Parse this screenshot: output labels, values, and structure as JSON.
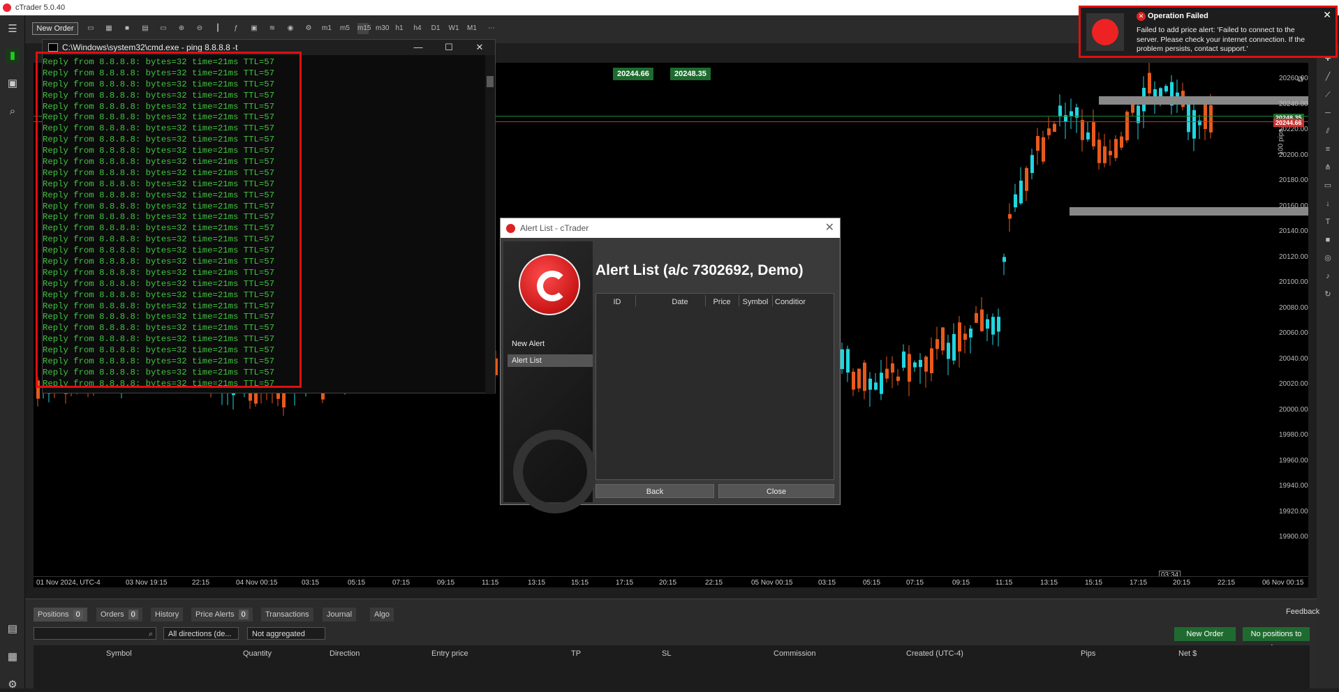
{
  "app": {
    "title": "cTrader 5.0.40"
  },
  "toolbar": {
    "new_order": "New Order",
    "timeframes": [
      "m1",
      "m5",
      "m15",
      "m30",
      "h1",
      "h4",
      "D1",
      "W1",
      "M1"
    ]
  },
  "cmd": {
    "title": "C:\\Windows\\system32\\cmd.exe - ping  8.8.8.8 -t",
    "lines": [
      "Reply from 8.8.8.8: bytes=32 time=21ms TTL=57",
      "Reply from 8.8.8.8: bytes=32 time=21ms TTL=57",
      "Reply from 8.8.8.8: bytes=32 time=21ms TTL=57",
      "Reply from 8.8.8.8: bytes=32 time=21ms TTL=57",
      "Reply from 8.8.8.8: bytes=32 time=21ms TTL=57",
      "Reply from 8.8.8.8: bytes=32 time=21ms TTL=57",
      "Reply from 8.8.8.8: bytes=32 time=21ms TTL=57",
      "Reply from 8.8.8.8: bytes=32 time=21ms TTL=57",
      "Reply from 8.8.8.8: bytes=32 time=21ms TTL=57",
      "Reply from 8.8.8.8: bytes=32 time=21ms TTL=57",
      "Reply from 8.8.8.8: bytes=32 time=21ms TTL=57",
      "Reply from 8.8.8.8: bytes=32 time=21ms TTL=57",
      "Reply from 8.8.8.8: bytes=32 time=21ms TTL=57",
      "Reply from 8.8.8.8: bytes=32 time=21ms TTL=57",
      "Reply from 8.8.8.8: bytes=32 time=21ms TTL=57",
      "Reply from 8.8.8.8: bytes=32 time=21ms TTL=57",
      "Reply from 8.8.8.8: bytes=32 time=21ms TTL=57",
      "Reply from 8.8.8.8: bytes=32 time=21ms TTL=57",
      "Reply from 8.8.8.8: bytes=32 time=21ms TTL=57",
      "Reply from 8.8.8.8: bytes=32 time=21ms TTL=57",
      "Reply from 8.8.8.8: bytes=32 time=21ms TTL=57",
      "Reply from 8.8.8.8: bytes=32 time=21ms TTL=57",
      "Reply from 8.8.8.8: bytes=32 time=21ms TTL=57",
      "Reply from 8.8.8.8: bytes=32 time=21ms TTL=57",
      "Reply from 8.8.8.8: bytes=32 time=21ms TTL=57",
      "Reply from 8.8.8.8: bytes=32 time=21ms TTL=57",
      "Reply from 8.8.8.8: bytes=32 time=21ms TTL=57",
      "Reply from 8.8.8.8: bytes=32 time=21ms TTL=57",
      "Reply from 8.8.8.8: bytes=32 time=21ms TTL=57",
      "Reply from 8.8.8.8: bytes=32 time=21ms TTL=57"
    ]
  },
  "alert_dialog": {
    "window_title": "Alert List - cTrader",
    "heading": "Alert List (a/c 7302692, Demo)",
    "sidebar": [
      "New Alert",
      "Alert List"
    ],
    "columns": [
      "ID",
      "Date",
      "Price",
      "Symbol",
      "Condition"
    ],
    "back": "Back",
    "close": "Close"
  },
  "toast": {
    "title": "Operation Failed",
    "message": "Failed to add price alert: 'Failed to connect to the server. Please check your internet connection. If the problem persists, contact support.'"
  },
  "chart": {
    "bid_badge": "20244.66",
    "ask_badge": "20248.35",
    "price_ask": "20248.35",
    "price_bid": "20244.66",
    "range_label": "100 pips",
    "timer": "03:34",
    "y_ticks": [
      "20260.00",
      "20240.00",
      "20220.00",
      "20200.00",
      "20180.00",
      "20160.00",
      "20140.00",
      "20120.00",
      "20100.00",
      "20080.00",
      "20060.00",
      "20040.00",
      "20020.00",
      "20000.00",
      "19980.00",
      "19960.00",
      "19940.00",
      "19920.00",
      "19900.00"
    ],
    "x_ticks": [
      "01 Nov 2024, UTC-4",
      "03 Nov 19:15",
      "22:15",
      "04 Nov 00:15",
      "03:15",
      "05:15",
      "07:15",
      "09:15",
      "11:15",
      "13:15",
      "15:15",
      "17:15",
      "20:15",
      "22:15",
      "05 Nov 00:15",
      "03:15",
      "05:15",
      "07:15",
      "09:15",
      "11:15",
      "13:15",
      "15:15",
      "17:15",
      "20:15",
      "22:15",
      "06 Nov 00:15"
    ]
  },
  "bottom": {
    "tabs": [
      {
        "label": "Positions",
        "count": "0"
      },
      {
        "label": "Orders",
        "count": "0"
      },
      {
        "label": "History",
        "count": ""
      },
      {
        "label": "Price Alerts",
        "count": "0"
      },
      {
        "label": "Transactions",
        "count": ""
      },
      {
        "label": "Journal",
        "count": ""
      },
      {
        "label": "Algo",
        "count": ""
      }
    ],
    "feedback": "Feedback",
    "direction_filter": "All directions (de...",
    "aggregation": "Not aggregated",
    "new_order": "New Order",
    "close_all": "No positions to close",
    "columns": [
      "Symbol",
      "Quantity",
      "Direction",
      "Entry price",
      "TP",
      "SL",
      "Commission",
      "Created (UTC-4)",
      "Pips",
      "Net $"
    ]
  },
  "colors": {
    "bull": "#1fd6e0",
    "bear": "#e85a1c",
    "alert_red": "#e01010",
    "green": "#1f6b2f"
  }
}
